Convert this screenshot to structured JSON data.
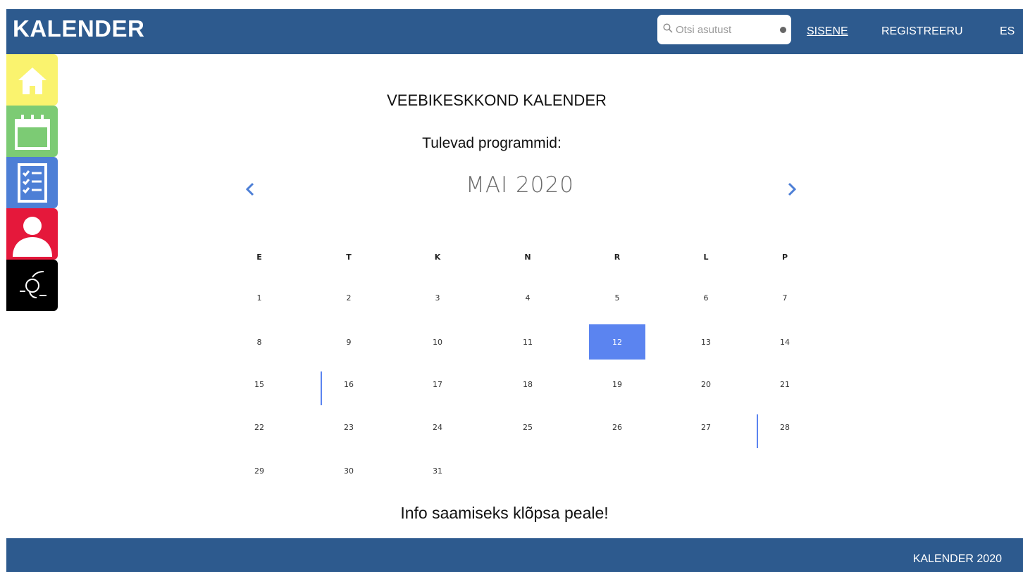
{
  "header": {
    "logo": "KALENDER",
    "search_placeholder": "Otsi asutust",
    "nav": {
      "login": "SISENE",
      "register": "REGISTREERU",
      "lang": "ES"
    }
  },
  "sidebar": {
    "items": [
      {
        "name": "home",
        "icon": "home-icon",
        "color": "#faf36e"
      },
      {
        "name": "calendar",
        "icon": "calendar-icon",
        "color": "#7ccb74"
      },
      {
        "name": "checklist",
        "icon": "checklist-icon",
        "color": "#4d7fd6"
      },
      {
        "name": "profile",
        "icon": "user-icon",
        "color": "#e5183b"
      },
      {
        "name": "brand",
        "icon": "brand-logo-icon",
        "color": "#000000"
      }
    ]
  },
  "main": {
    "title": "VEEBIKESKKOND KALENDER",
    "subtitle": "Tulevad programmid:",
    "month_label": "MAI 2020",
    "info": "Info saamiseks klõpsa peale!"
  },
  "calendar": {
    "weekdays": [
      "E",
      "T",
      "K",
      "N",
      "R",
      "L",
      "P"
    ],
    "weeks": [
      [
        "1",
        "2",
        "3",
        "4",
        "5",
        "6",
        "7"
      ],
      [
        "8",
        "9",
        "10",
        "11",
        "12",
        "13",
        "14"
      ],
      [
        "15",
        "16",
        "17",
        "18",
        "19",
        "20",
        "21"
      ],
      [
        "22",
        "23",
        "24",
        "25",
        "26",
        "27",
        "28"
      ],
      [
        "29",
        "30",
        "31",
        "",
        "",
        "",
        ""
      ]
    ],
    "selected_day": "12",
    "event_days": [
      "16",
      "28"
    ],
    "accent_color": "#5b84f0"
  },
  "footer": {
    "text": "KALENDER 2020"
  },
  "colors": {
    "brand": "#2d5a8e"
  }
}
